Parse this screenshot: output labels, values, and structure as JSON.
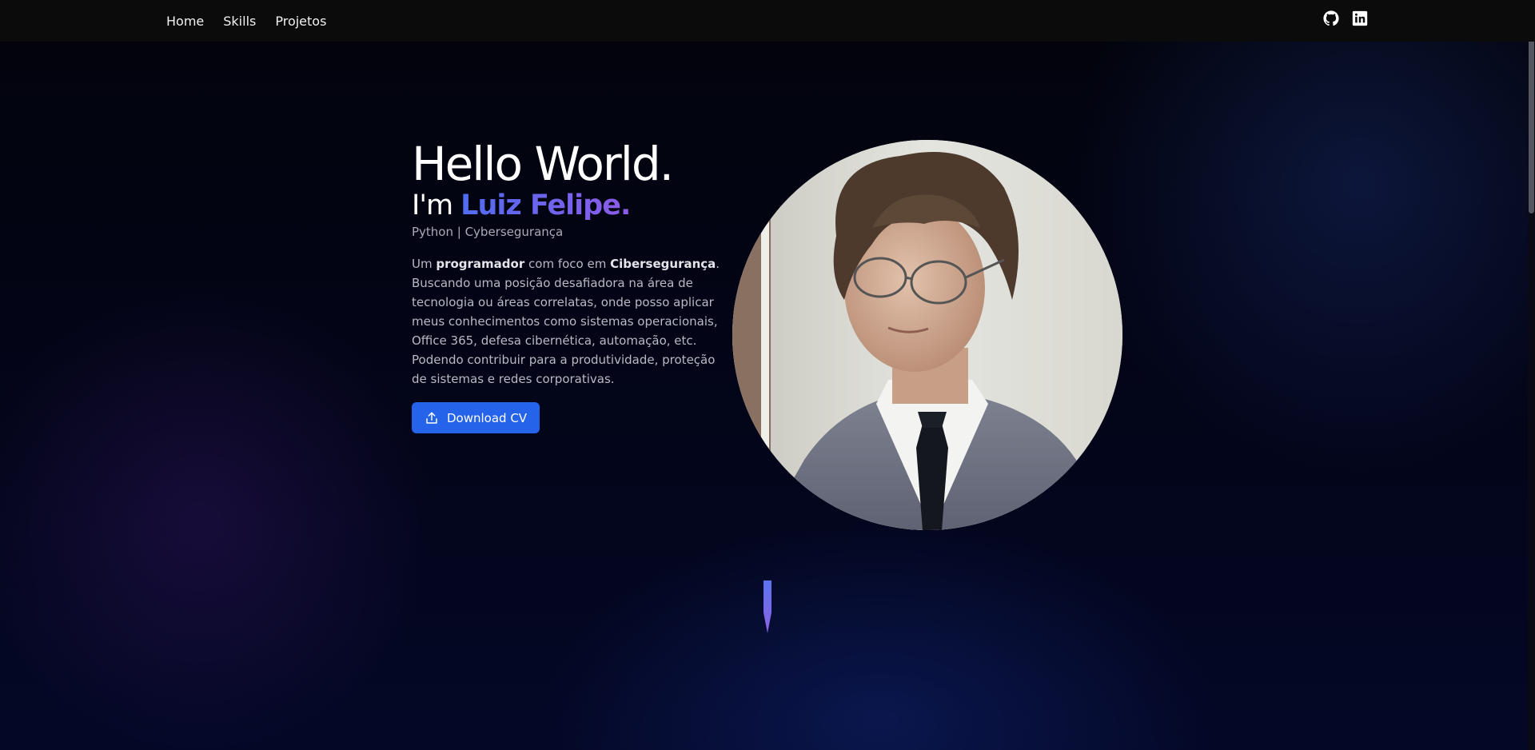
{
  "nav": {
    "links": [
      "Home",
      "Skills",
      "Projetos"
    ],
    "icons": [
      "github-icon",
      "linkedin-icon"
    ]
  },
  "hero": {
    "greeting": "Hello World.",
    "intro_prefix": "I'm ",
    "name": "Luiz Felipe.",
    "role": "Python | Cybersegurança",
    "bio": {
      "p1": "Um ",
      "strong1": "programador",
      "p2": " com foco em ",
      "strong2": "Cibersegurança",
      "p3": ". Buscando uma posição desafiadora na área de tecnologia ou áreas correlatas, onde posso aplicar meus conhecimentos como sistemas operacionais, Office 365, defesa cibernética, automação, etc. Podendo contribuir para a produtividade, proteção de sistemas e redes corporativas."
    },
    "cv_button_label": "Download CV",
    "photo_alt": "profile-photo"
  },
  "colors": {
    "accent": "#2563eb",
    "name_gradient_start": "#4f6df0",
    "name_gradient_end": "#8d5be8",
    "navbar": "#0b0b0c"
  }
}
